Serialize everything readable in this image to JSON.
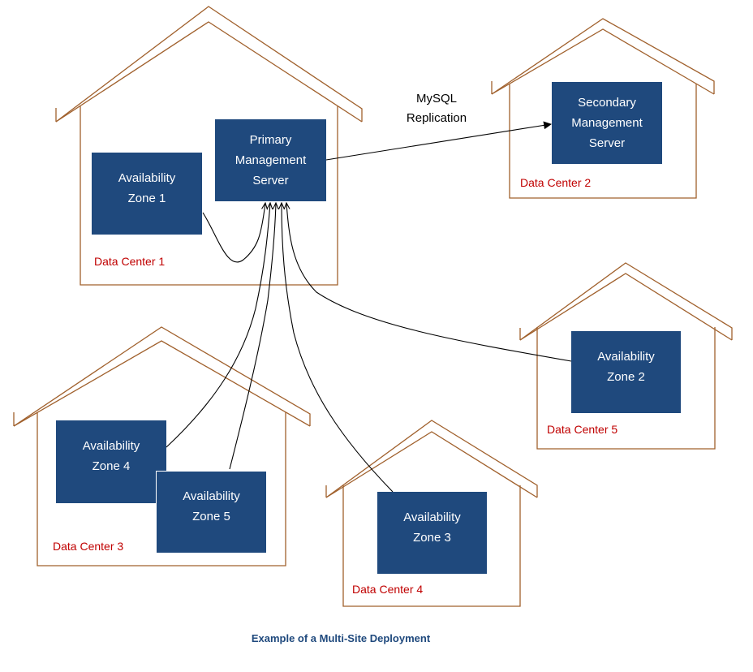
{
  "caption": "Example of a Multi-Site Deployment",
  "colors": {
    "box_fill": "#1f497d",
    "box_text": "#ffffff",
    "house_outline": "#a0602c",
    "datacenter_label": "#c00000",
    "caption": "#1f497d",
    "connector": "#000000"
  },
  "data_centers": [
    {
      "id": "dc1",
      "label": "Data Center 1"
    },
    {
      "id": "dc2",
      "label": "Data Center 2"
    },
    {
      "id": "dc3",
      "label": "Data Center 3"
    },
    {
      "id": "dc4",
      "label": "Data Center 4"
    },
    {
      "id": "dc5",
      "label": "Data Center 5"
    }
  ],
  "nodes": {
    "primary": {
      "line1": "Primary",
      "line2": "Management",
      "line3": "Server",
      "data_center": "dc1"
    },
    "secondary": {
      "line1": "Secondary",
      "line2": "Management",
      "line3": "Server",
      "data_center": "dc2"
    },
    "az1": {
      "line1": "Availability",
      "line2": "Zone 1",
      "data_center": "dc1"
    },
    "az2": {
      "line1": "Availability",
      "line2": "Zone 2",
      "data_center": "dc5"
    },
    "az3": {
      "line1": "Availability",
      "line2": "Zone 3",
      "data_center": "dc4"
    },
    "az4": {
      "line1": "Availability",
      "line2": "Zone 4",
      "data_center": "dc3"
    },
    "az5": {
      "line1": "Availability",
      "line2": "Zone 5",
      "data_center": "dc3"
    }
  },
  "edges": [
    {
      "from": "primary",
      "to": "secondary",
      "label_line1": "MySQL",
      "label_line2": "Replication"
    },
    {
      "from": "az1",
      "to": "primary"
    },
    {
      "from": "az2",
      "to": "primary"
    },
    {
      "from": "az3",
      "to": "primary"
    },
    {
      "from": "az4",
      "to": "primary"
    },
    {
      "from": "az5",
      "to": "primary"
    }
  ]
}
